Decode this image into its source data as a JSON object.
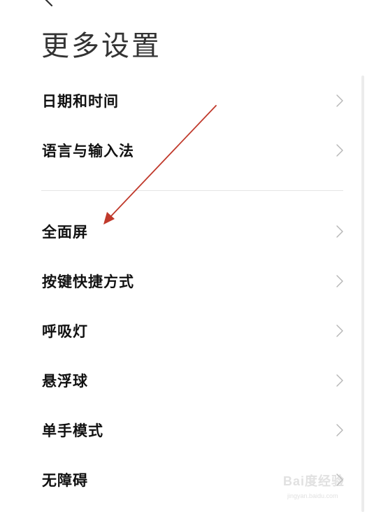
{
  "header": {
    "title": "更多设置",
    "back_icon": "chevron-left-icon"
  },
  "settings": {
    "group1": [
      {
        "label": "日期和时间"
      },
      {
        "label": "语言与输入法"
      }
    ],
    "group2": [
      {
        "label": "全面屏"
      },
      {
        "label": "按键快捷方式"
      },
      {
        "label": "呼吸灯"
      },
      {
        "label": "悬浮球"
      },
      {
        "label": "单手模式"
      },
      {
        "label": "无障碍"
      }
    ],
    "row_icon": "chevron-right-icon"
  },
  "annotation": {
    "color": "#c0392b"
  },
  "watermark": {
    "brand": "Bai度经验",
    "url": "jingyan.baidu.com"
  }
}
